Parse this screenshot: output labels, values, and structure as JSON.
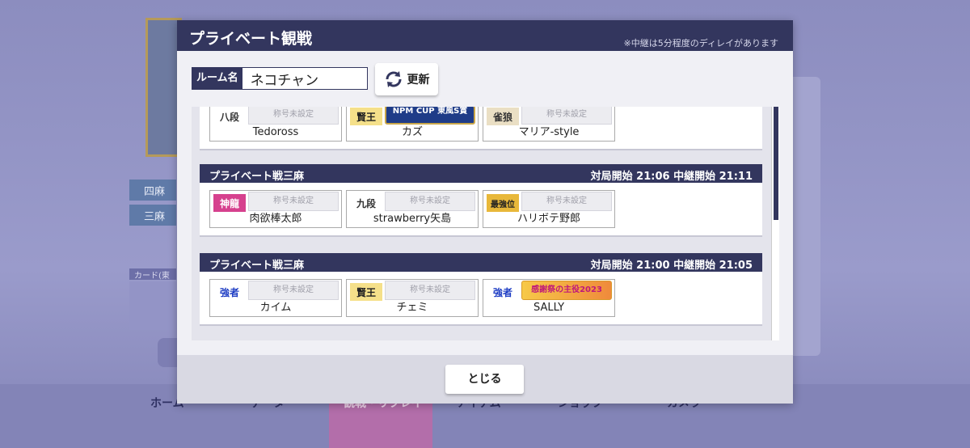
{
  "background": {
    "mode_buttons": [
      "四麻",
      "三麻"
    ],
    "card_label": "カード(東",
    "nav": [
      "ホーム",
      "データ",
      "観戦・リプレイ",
      "アイテム",
      "ショップ",
      "カメラ"
    ]
  },
  "modal": {
    "title": "プライベート観戦",
    "note": "※中継は5分程度のディレイがあります",
    "room_label": "ルーム名",
    "room_value": "ネコチャン",
    "refresh_label": "更新",
    "close_label": "とじる"
  },
  "matches": [
    {
      "name": "",
      "time": "",
      "players": [
        {
          "rank": "八段",
          "title": "称号未設定",
          "name": "Tedoross"
        },
        {
          "rank": "賢王",
          "title": "NPM CUP 東風S賞",
          "name": "カズ"
        },
        {
          "rank": "雀狼",
          "title": "称号未設定",
          "name": "マリア-style"
        }
      ]
    },
    {
      "name": "プライベート戦三麻",
      "time": "対局開始 21:06 中継開始 21:11",
      "players": [
        {
          "rank": "神龍",
          "title": "称号未設定",
          "name": "肉欲棒太郎"
        },
        {
          "rank": "九段",
          "title": "称号未設定",
          "name": "strawberry矢島"
        },
        {
          "rank": "最強位",
          "title": "称号未設定",
          "name": "ハリボテ野郎"
        }
      ]
    },
    {
      "name": "プライベート戦三麻",
      "time": "対局開始 21:00 中継開始 21:05",
      "players": [
        {
          "rank": "強者",
          "title": "称号未設定",
          "name": "カイム"
        },
        {
          "rank": "賢王",
          "title": "称号未設定",
          "name": "チェミ"
        },
        {
          "rank": "強者",
          "title": "感謝祭の主役2023",
          "name": "SALLY"
        }
      ]
    }
  ],
  "colors": {
    "header": "#33365e",
    "accent": "#f0f0f5"
  }
}
